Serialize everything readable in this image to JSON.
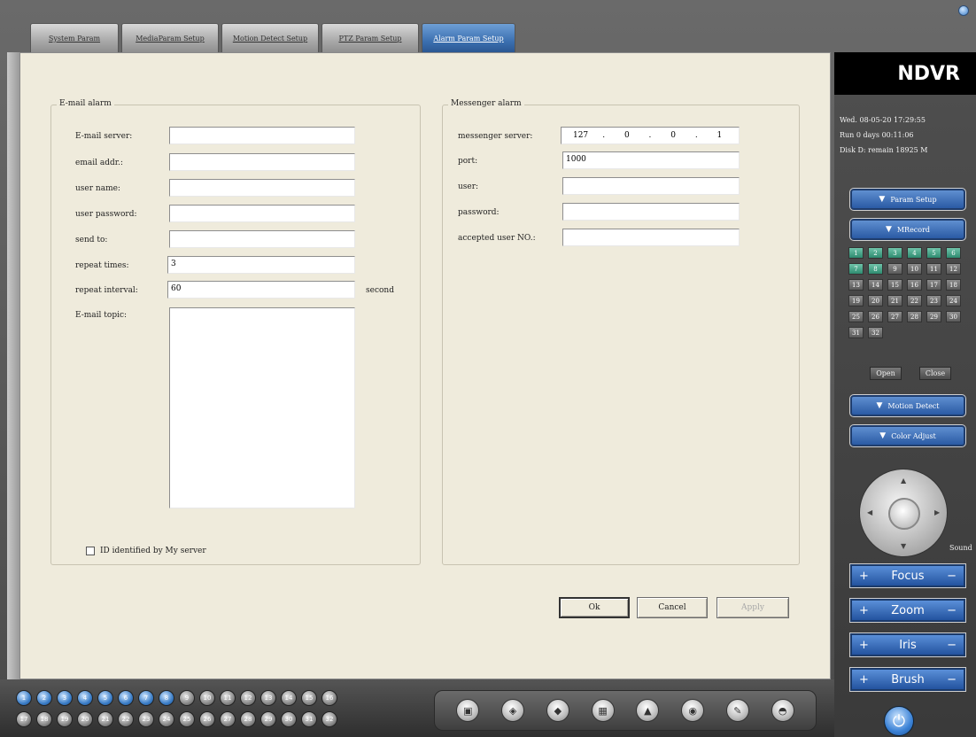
{
  "tabs": [
    {
      "label": "System Param"
    },
    {
      "label": "MediaParam Setup"
    },
    {
      "label": "Motion Detect Setup"
    },
    {
      "label": "PTZ Param Setup"
    },
    {
      "label": "Alarm Param Setup"
    }
  ],
  "email_alarm": {
    "title": "E-mail alarm",
    "server_label": "E-mail server:",
    "server_value": "",
    "addr_label": "email addr.:",
    "addr_value": "",
    "user_label": "user name:",
    "user_value": "",
    "password_label": "user password:",
    "password_value": "",
    "sendto_label": "send to:",
    "sendto_value": "",
    "repeat_times_label": "repeat times:",
    "repeat_times_value": "3",
    "repeat_interval_label": "repeat interval:",
    "repeat_interval_value": "60",
    "interval_unit": "second",
    "topic_label": "E-mail topic:",
    "topic_value": "",
    "checkbox_label": "ID identified by  My server"
  },
  "messenger_alarm": {
    "title": "Messenger alarm",
    "server_label": "messenger server:",
    "ip": [
      "127",
      "0",
      "0",
      "1"
    ],
    "port_label": "port:",
    "port_value": "1000",
    "user_label": "user:",
    "user_value": "",
    "password_label": "password:",
    "password_value": "",
    "accepted_label": "accepted user NO.:",
    "accepted_value": ""
  },
  "buttons": {
    "ok": "Ok",
    "cancel": "Cancel",
    "apply": "Apply"
  },
  "right_panel": {
    "brand": "NDVR",
    "date_line": "Wed.   08-05-20 17:29:55",
    "run_line": "Run 0 days 00:11:06",
    "disk_line": "Disk D: remain 18925 M",
    "param_setup": "Param Setup",
    "record": "MRecord",
    "channels_on": [
      "1",
      "2",
      "3",
      "4",
      "5",
      "6",
      "7",
      "8"
    ],
    "channels_off": [
      "9",
      "10",
      "11",
      "12",
      "13",
      "14",
      "15",
      "16",
      "17",
      "18",
      "19",
      "20",
      "21",
      "22",
      "23",
      "24",
      "25",
      "26",
      "27",
      "28",
      "29",
      "30",
      "31",
      "32"
    ],
    "open_btn": "Open",
    "close_btn": "Close",
    "motion_detect": "Motion Detect",
    "color_adjust": "Color Adjust",
    "sound": "Sound",
    "focus": "Focus",
    "zoom": "Zoom",
    "iris": "Iris",
    "brush": "Brush"
  },
  "bottom_bar": {
    "channels_row1": [
      "1",
      "2",
      "3",
      "4",
      "5",
      "6",
      "7",
      "8",
      "9",
      "10",
      "11",
      "12",
      "13",
      "14",
      "15",
      "16"
    ],
    "channels_row2": [
      "17",
      "18",
      "19",
      "20",
      "21",
      "22",
      "23",
      "24",
      "25",
      "26",
      "27",
      "28",
      "29",
      "30",
      "31",
      "32"
    ]
  }
}
